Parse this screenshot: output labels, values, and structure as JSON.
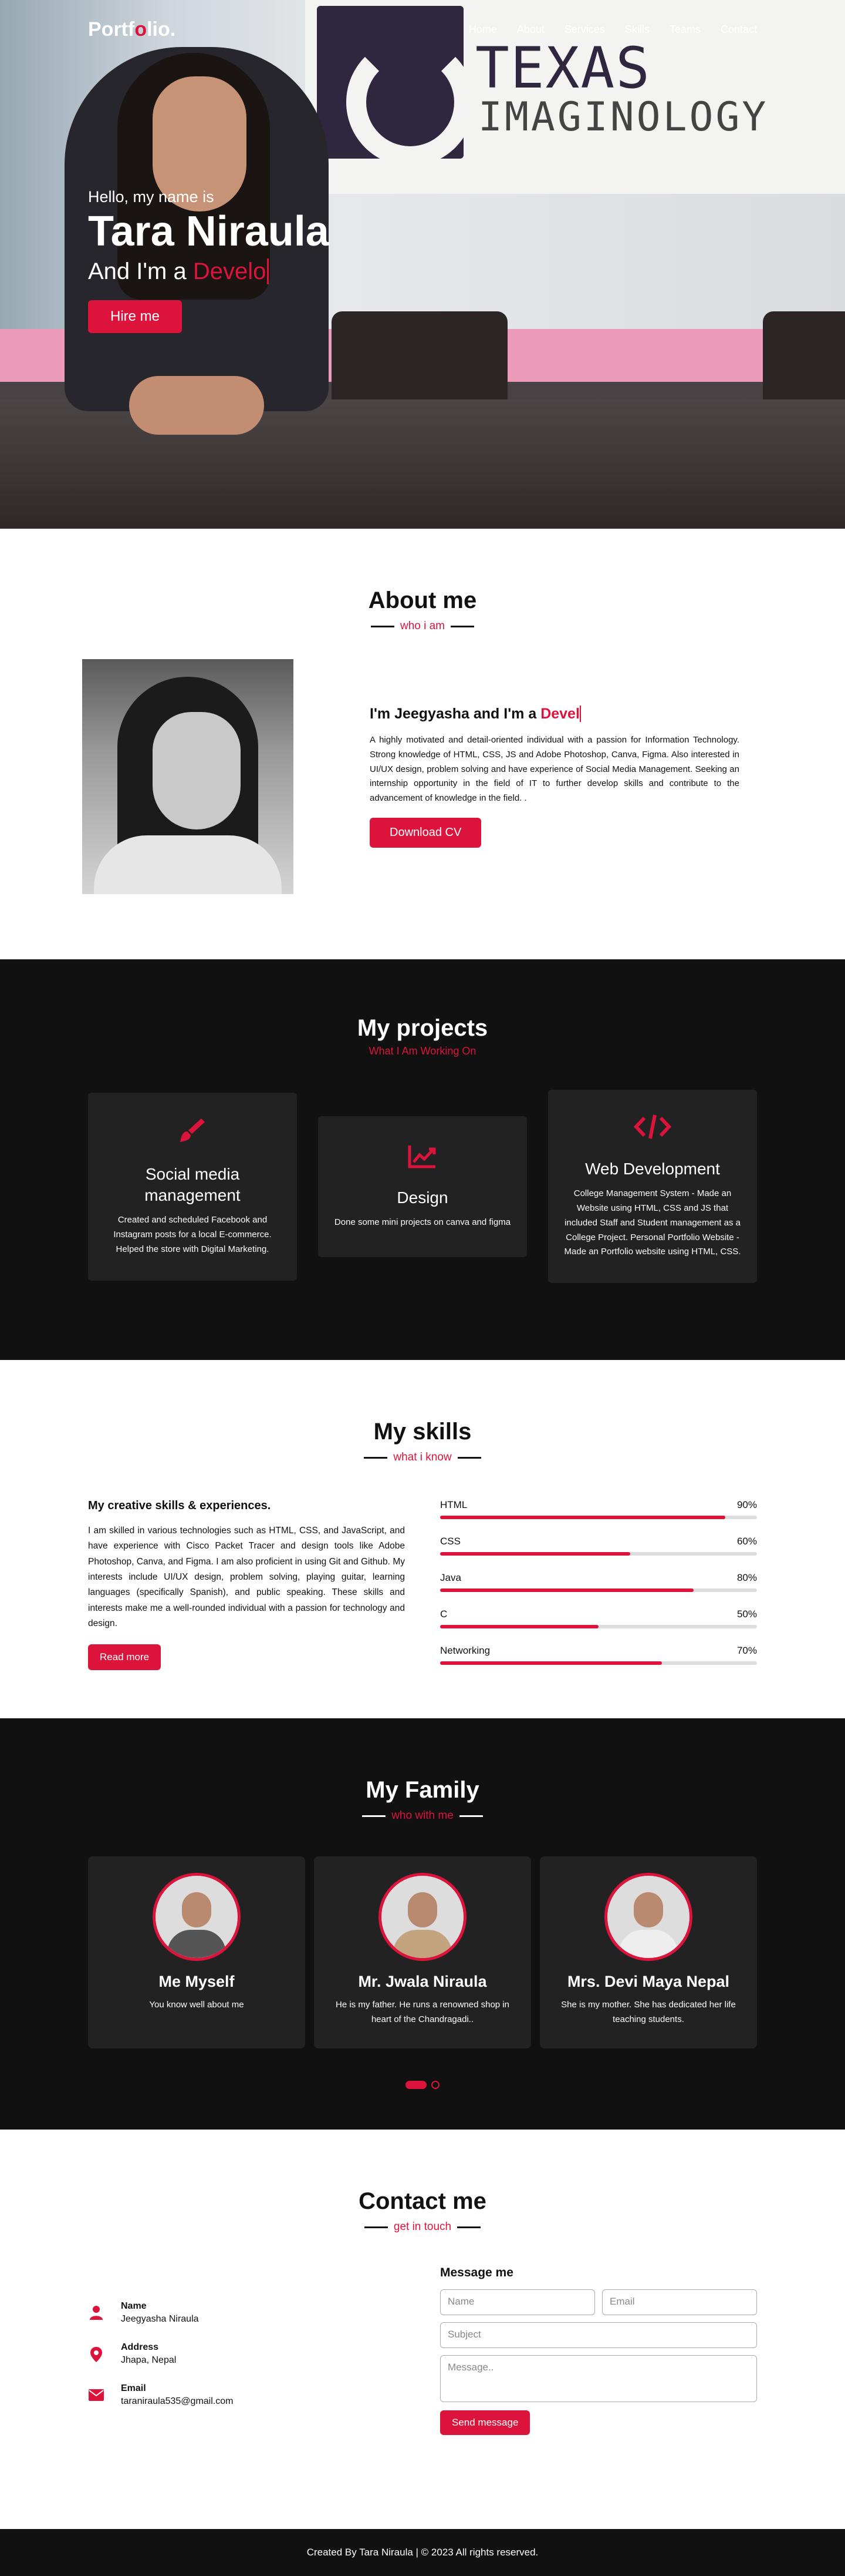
{
  "colors": {
    "accent": "#dc143c",
    "dark": "#111111",
    "card": "#222222"
  },
  "nav": {
    "logo_a": "Portf",
    "logo_b": "o",
    "logo_c": "lio.",
    "items": [
      "Home",
      "About",
      "Services",
      "Skills",
      "Teams",
      "Contact"
    ]
  },
  "hero": {
    "greeting": "Hello, my name is",
    "name": "Tara Niraula",
    "role_prefix": "And I'm a ",
    "role_typed": "Develo",
    "cta": "Hire me",
    "sign_line1": "TEXAS",
    "sign_line2": "IMAGINOLOGY"
  },
  "about": {
    "title": "About me",
    "subtitle": "who i am",
    "headline_prefix": "I'm Jeegyasha and I'm a ",
    "headline_typed": "Devel",
    "body": "A highly motivated and detail-oriented individual with a passion for Information Technology. Strong knowledge of HTML, CSS, JS and Adobe Photoshop, Canva, Figma. Also interested in UI/UX design, problem solving and have experience of Social Media Management. Seeking an internship opportunity in the field of IT to further develop skills and contribute to the advancement of knowledge in the field. .",
    "button": "Download CV"
  },
  "projects": {
    "title": "My projects",
    "subtitle": "What I Am Working On",
    "cards": [
      {
        "icon": "paint-brush-icon",
        "title": "Social media management",
        "text": "Created and scheduled Facebook and Instagram posts for a local E-commerce. Helped the store with Digital Marketing."
      },
      {
        "icon": "chart-line-icon",
        "title": "Design",
        "text": "Done some mini projects on canva and figma"
      },
      {
        "icon": "code-icon",
        "title": "Web Development",
        "text": "College Management System - Made an Website using HTML, CSS and JS that included Staff and Student management as a College Project. Personal Portfolio Website - Made an Portfolio website using HTML, CSS."
      }
    ]
  },
  "skills": {
    "title": "My skills",
    "subtitle": "what i know",
    "heading": "My creative skills & experiences.",
    "body": "I am skilled in various technologies such as HTML, CSS, and JavaScript, and have experience with Cisco Packet Tracer and design tools like Adobe Photoshop, Canva, and Figma. I am also proficient in using Git and Github. My interests include UI/UX design, problem solving, playing guitar, learning languages (specifically Spanish), and public speaking. These skills and interests make me a well-rounded individual with a passion for technology and design.",
    "button": "Read more",
    "bars": [
      {
        "name": "HTML",
        "pct": "90%",
        "value": 90
      },
      {
        "name": "CSS",
        "pct": "60%",
        "value": 60
      },
      {
        "name": "Java",
        "pct": "80%",
        "value": 80
      },
      {
        "name": "C",
        "pct": "50%",
        "value": 50
      },
      {
        "name": "Networking",
        "pct": "70%",
        "value": 70
      }
    ]
  },
  "family": {
    "title": "My Family",
    "subtitle": "who with me",
    "members": [
      {
        "name": "Me Myself",
        "text": "You know well about me"
      },
      {
        "name": "Mr. Jwala Niraula",
        "text": "He is my father. He runs a renowned shop in heart of the Chandragadi.."
      },
      {
        "name": "Mrs. Devi Maya Nepal",
        "text": "She is my mother. She has dedicated her life teaching students."
      }
    ]
  },
  "contact": {
    "title": "Contact me",
    "subtitle": "get in touch",
    "info": [
      {
        "icon": "user-icon",
        "head": "Name",
        "value": "Jeegyasha Niraula"
      },
      {
        "icon": "map-marker-icon",
        "head": "Address",
        "value": "Jhapa, Nepal"
      },
      {
        "icon": "envelope-icon",
        "head": "Email",
        "value": "taraniraula535@gmail.com"
      }
    ],
    "form_title": "Message me",
    "placeholders": {
      "name": "Name",
      "email": "Email",
      "subject": "Subject",
      "message": "Message.."
    },
    "send": "Send message"
  },
  "footer": {
    "text": "Created By Tara Niraula | © 2023 All rights reserved."
  }
}
